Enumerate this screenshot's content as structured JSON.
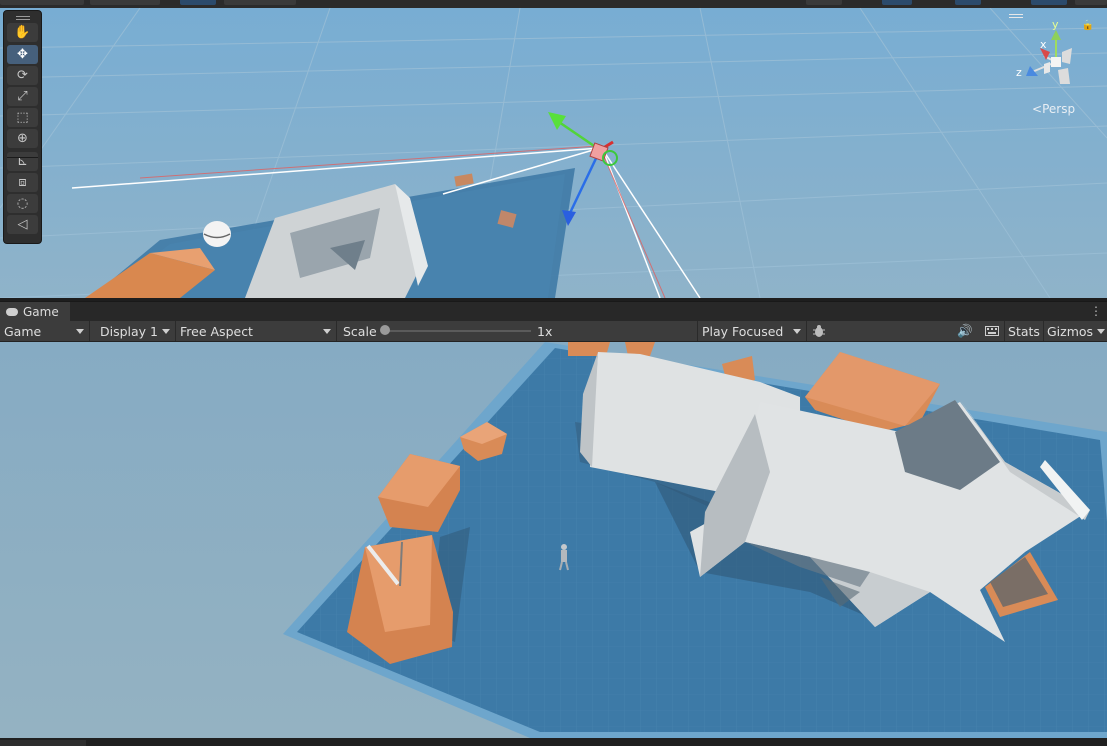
{
  "scene_view": {
    "projection_label": "Persp",
    "axis_labels": {
      "x": "x",
      "y": "y",
      "z": "z"
    },
    "tools": [
      {
        "name": "hand-tool-icon",
        "glyph": "✋",
        "active": false
      },
      {
        "name": "move-tool-icon",
        "glyph": "✥",
        "active": true
      },
      {
        "name": "rotate-tool-icon",
        "glyph": "⟳",
        "active": false
      },
      {
        "name": "scale-tool-icon",
        "glyph": "⤢",
        "active": false
      },
      {
        "name": "rect-tool-icon",
        "glyph": "⬚",
        "active": false
      },
      {
        "name": "transform-tool-icon",
        "glyph": "⊕",
        "active": false
      },
      {
        "name": "custom-tool-1-icon",
        "glyph": "⊾",
        "active": false
      },
      {
        "name": "custom-tool-2-icon",
        "glyph": "⧈",
        "active": false
      },
      {
        "name": "custom-tool-3-icon",
        "glyph": "◌",
        "active": false
      },
      {
        "name": "custom-tool-4-icon",
        "glyph": "◁",
        "active": false
      }
    ]
  },
  "game_panel": {
    "tab_label": "Game",
    "toolbar": {
      "mode": "Game",
      "display": "Display 1",
      "aspect": "Free Aspect",
      "scale_label": "Scale",
      "scale_value": "1x",
      "play_mode": "Play Focused",
      "stats": "Stats",
      "gizmos": "Gizmos"
    }
  },
  "colors": {
    "sky": "#8aaec4",
    "ground": "#3f7aa6",
    "wall": "#d9dcdd",
    "crate": "#d9884f",
    "accent_active": "#46607c"
  }
}
